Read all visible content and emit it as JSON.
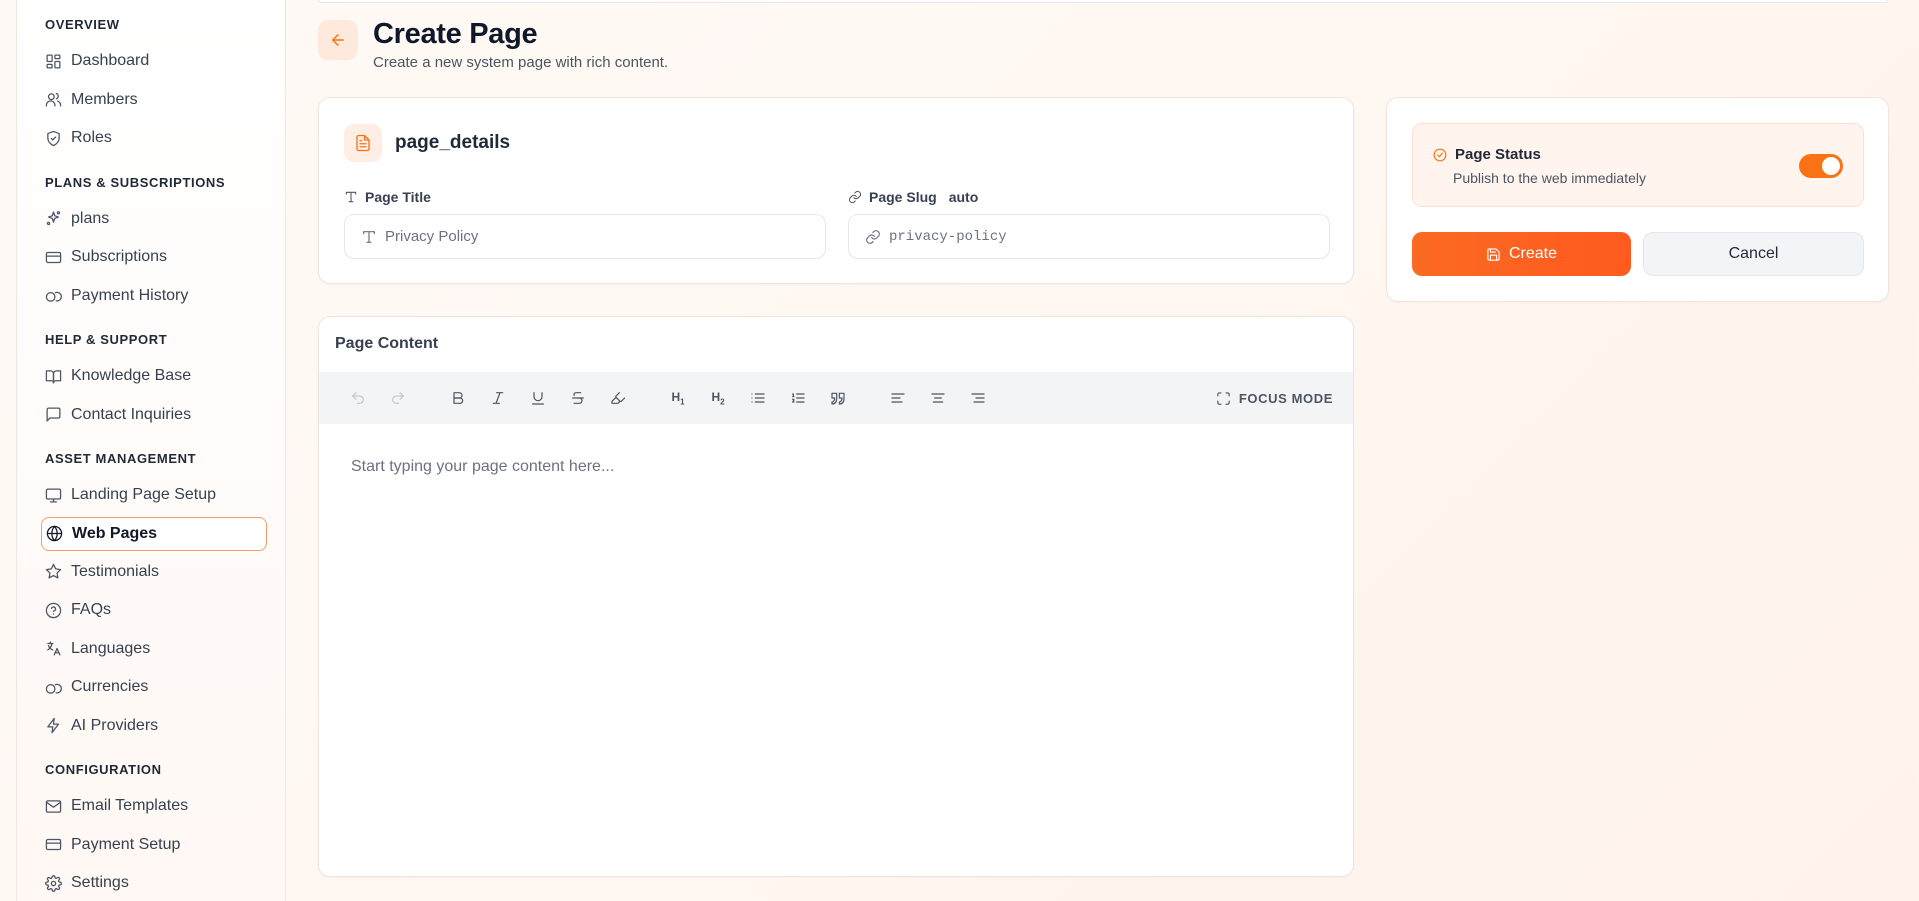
{
  "sidebar": {
    "sections": [
      {
        "title": "OVERVIEW",
        "items": [
          {
            "label": "Dashboard",
            "icon": "dashboard-icon"
          },
          {
            "label": "Members",
            "icon": "users-icon"
          },
          {
            "label": "Roles",
            "icon": "shield-icon"
          }
        ]
      },
      {
        "title": "PLANS & SUBSCRIPTIONS",
        "items": [
          {
            "label": "plans",
            "icon": "sparkles-icon"
          },
          {
            "label": "Subscriptions",
            "icon": "credit-card-icon"
          },
          {
            "label": "Payment History",
            "icon": "coins-icon"
          }
        ]
      },
      {
        "title": "HELP & SUPPORT",
        "items": [
          {
            "label": "Knowledge Base",
            "icon": "book-icon"
          },
          {
            "label": "Contact Inquiries",
            "icon": "message-icon"
          }
        ]
      },
      {
        "title": "ASSET MANAGEMENT",
        "items": [
          {
            "label": "Landing Page Setup",
            "icon": "monitor-icon"
          },
          {
            "label": "Web Pages",
            "icon": "globe-icon",
            "active": true
          },
          {
            "label": "Testimonials",
            "icon": "star-icon"
          },
          {
            "label": "FAQs",
            "icon": "help-circle-icon"
          },
          {
            "label": "Languages",
            "icon": "languages-icon"
          },
          {
            "label": "Currencies",
            "icon": "coins-icon"
          },
          {
            "label": "AI Providers",
            "icon": "zap-icon"
          }
        ]
      },
      {
        "title": "CONFIGURATION",
        "items": [
          {
            "label": "Email Templates",
            "icon": "mail-icon"
          },
          {
            "label": "Payment Setup",
            "icon": "credit-card-icon"
          },
          {
            "label": "Settings",
            "icon": "gear-icon"
          }
        ]
      }
    ]
  },
  "header": {
    "title": "Create Page",
    "subtitle": "Create a new system page with rich content."
  },
  "details": {
    "title": "page_details",
    "page_title_label": "Page Title",
    "page_title_placeholder": "Privacy Policy",
    "page_slug_label": "Page Slug",
    "page_slug_tag": "auto",
    "page_slug_placeholder": "privacy-policy"
  },
  "content": {
    "label": "Page Content",
    "focus_mode_label": "FOCUS MODE",
    "editor_placeholder": "Start typing your page content here..."
  },
  "status": {
    "title": "Page Status",
    "subtitle": "Publish to the web immediately",
    "published": true
  },
  "actions": {
    "create_label": "Create",
    "cancel_label": "Cancel"
  },
  "colors": {
    "accent": "#f97316",
    "accent_light": "#ffe9dc"
  }
}
